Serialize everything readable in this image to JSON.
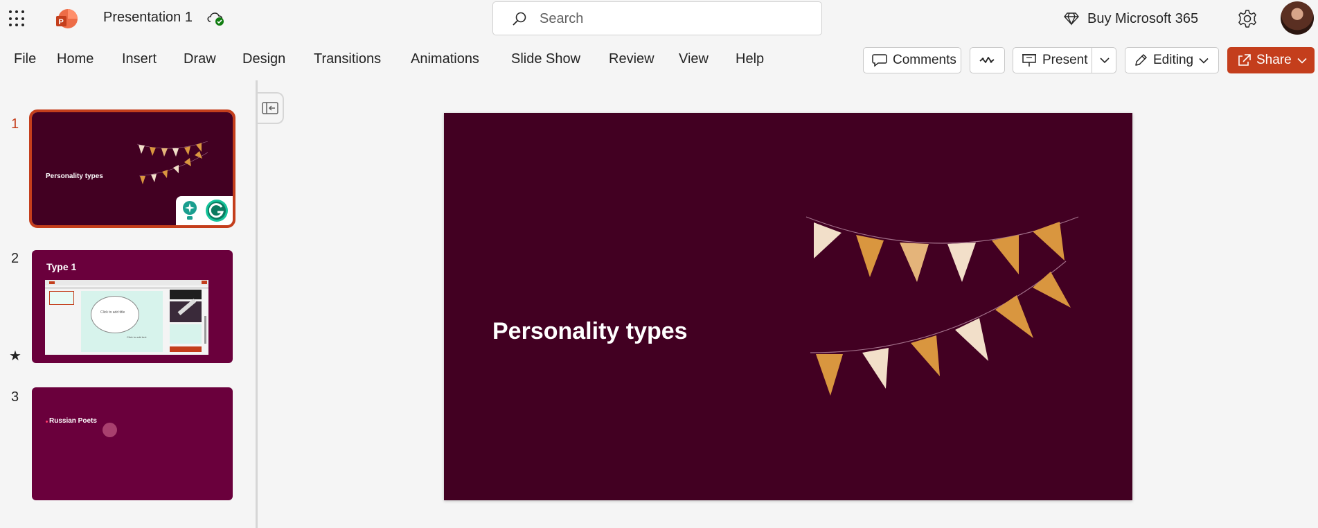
{
  "app": {
    "document_title": "Presentation 1",
    "search_placeholder": "Search",
    "buy_label": "Buy Microsoft 365",
    "icons": {
      "app_launcher": "waffle-icon",
      "logo": "powerpoint-logo",
      "cloud": "cloud-saved-icon",
      "search": "search-icon",
      "buy": "diamond-icon",
      "settings": "gear-icon"
    }
  },
  "ribbon": {
    "tabs": [
      "File",
      "Home",
      "Insert",
      "Draw",
      "Design",
      "Transitions",
      "Animations",
      "Slide Show",
      "Review",
      "View",
      "Help"
    ],
    "comments_label": "Comments",
    "present_label": "Present",
    "editing_label": "Editing",
    "share_label": "Share",
    "colors": {
      "share_bg": "#c43e1c"
    }
  },
  "slides": [
    {
      "number": "1",
      "title": "Personality types",
      "selected": true,
      "bg": "#420022"
    },
    {
      "number": "2",
      "title": "Type 1",
      "selected": false,
      "bg": "#6a003c",
      "inner_text_1": "Click to add title",
      "inner_text_2": "Click to add text"
    },
    {
      "number": "3",
      "title": "Russian Poets",
      "selected": false,
      "bg": "#6a003c"
    }
  ],
  "main_slide": {
    "title": "Personality types",
    "bg": "#420022",
    "accent_colors": [
      "#f2dfc9",
      "#d9963f",
      "#e4b47a"
    ]
  }
}
